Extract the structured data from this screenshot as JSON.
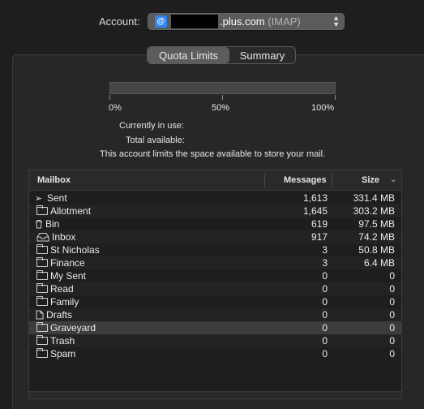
{
  "account": {
    "label": "Account:",
    "domain": ".plus.com",
    "type": "(IMAP)"
  },
  "tabs": [
    {
      "label": "Quota Limits",
      "active": true
    },
    {
      "label": "Summary",
      "active": false
    }
  ],
  "quota": {
    "used_fraction": 0,
    "ticks": [
      "0%",
      "50%",
      "100%"
    ],
    "currently_in_use_label": "Currently in use:",
    "total_available_label": "Total available:",
    "note": "This account limits the space available to store your mail."
  },
  "table": {
    "columns": [
      "Mailbox",
      "Messages",
      "Size"
    ],
    "rows": [
      {
        "icon": "paper-plane-icon",
        "name": "Sent",
        "messages": "1,613",
        "size": "331.4 MB"
      },
      {
        "icon": "folder-icon",
        "name": "Allotment",
        "messages": "1,645",
        "size": "303.2 MB"
      },
      {
        "icon": "trash-icon",
        "name": "Bin",
        "messages": "619",
        "size": "97.5 MB"
      },
      {
        "icon": "inbox-icon",
        "name": "Inbox",
        "messages": "917",
        "size": "74.2 MB"
      },
      {
        "icon": "folder-icon",
        "name": "St Nicholas",
        "messages": "3",
        "size": "50.8 MB"
      },
      {
        "icon": "folder-icon",
        "name": "Finance",
        "messages": "3",
        "size": "6.4 MB"
      },
      {
        "icon": "folder-icon",
        "name": "My Sent",
        "messages": "0",
        "size": "0"
      },
      {
        "icon": "folder-icon",
        "name": "Read",
        "messages": "0",
        "size": "0"
      },
      {
        "icon": "folder-icon",
        "name": "Family",
        "messages": "0",
        "size": "0"
      },
      {
        "icon": "document-icon",
        "name": "Drafts",
        "messages": "0",
        "size": "0"
      },
      {
        "icon": "folder-icon",
        "name": "Graveyard",
        "messages": "0",
        "size": "0",
        "selected": true
      },
      {
        "icon": "folder-icon",
        "name": "Trash",
        "messages": "0",
        "size": "0"
      },
      {
        "icon": "folder-icon",
        "name": "Spam",
        "messages": "0",
        "size": "0"
      }
    ]
  }
}
